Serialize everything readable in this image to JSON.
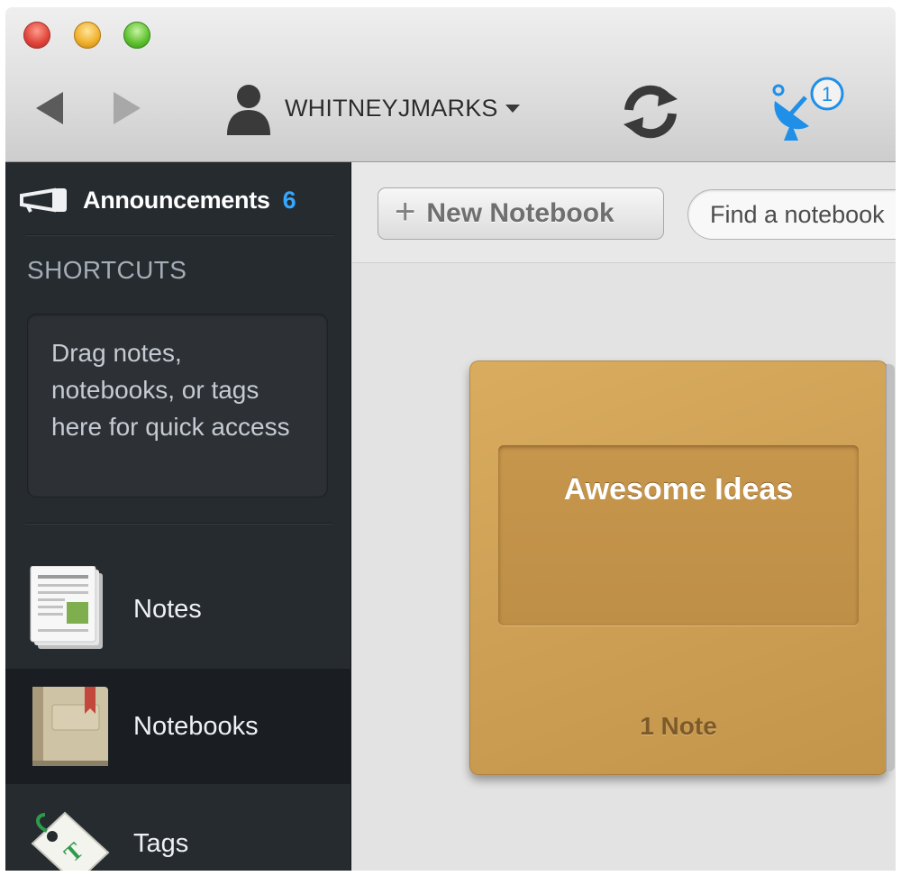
{
  "toolbar": {
    "username": "WHITNEYJMARKS",
    "activity_badge": "1"
  },
  "sidebar": {
    "announcements_label": "Announcements",
    "announcements_count": "6",
    "shortcuts_heading": "SHORTCUTS",
    "shortcuts_hint": "Drag notes, notebooks, or tags here for quick access",
    "items": [
      {
        "label": "Notes",
        "icon": "notes-icon",
        "active": false
      },
      {
        "label": "Notebooks",
        "icon": "notebooks-icon",
        "active": true
      },
      {
        "label": "Tags",
        "icon": "tags-icon",
        "active": false
      }
    ]
  },
  "main": {
    "new_notebook_label": "New Notebook",
    "find_placeholder": "Find a notebook",
    "notebooks": [
      {
        "title": "Awesome Ideas",
        "count_label": "1 Note"
      }
    ]
  },
  "colors": {
    "sidebar_bg": "#262b30",
    "accent_blue": "#35a7ff",
    "notebook_tan": "#cea156"
  }
}
